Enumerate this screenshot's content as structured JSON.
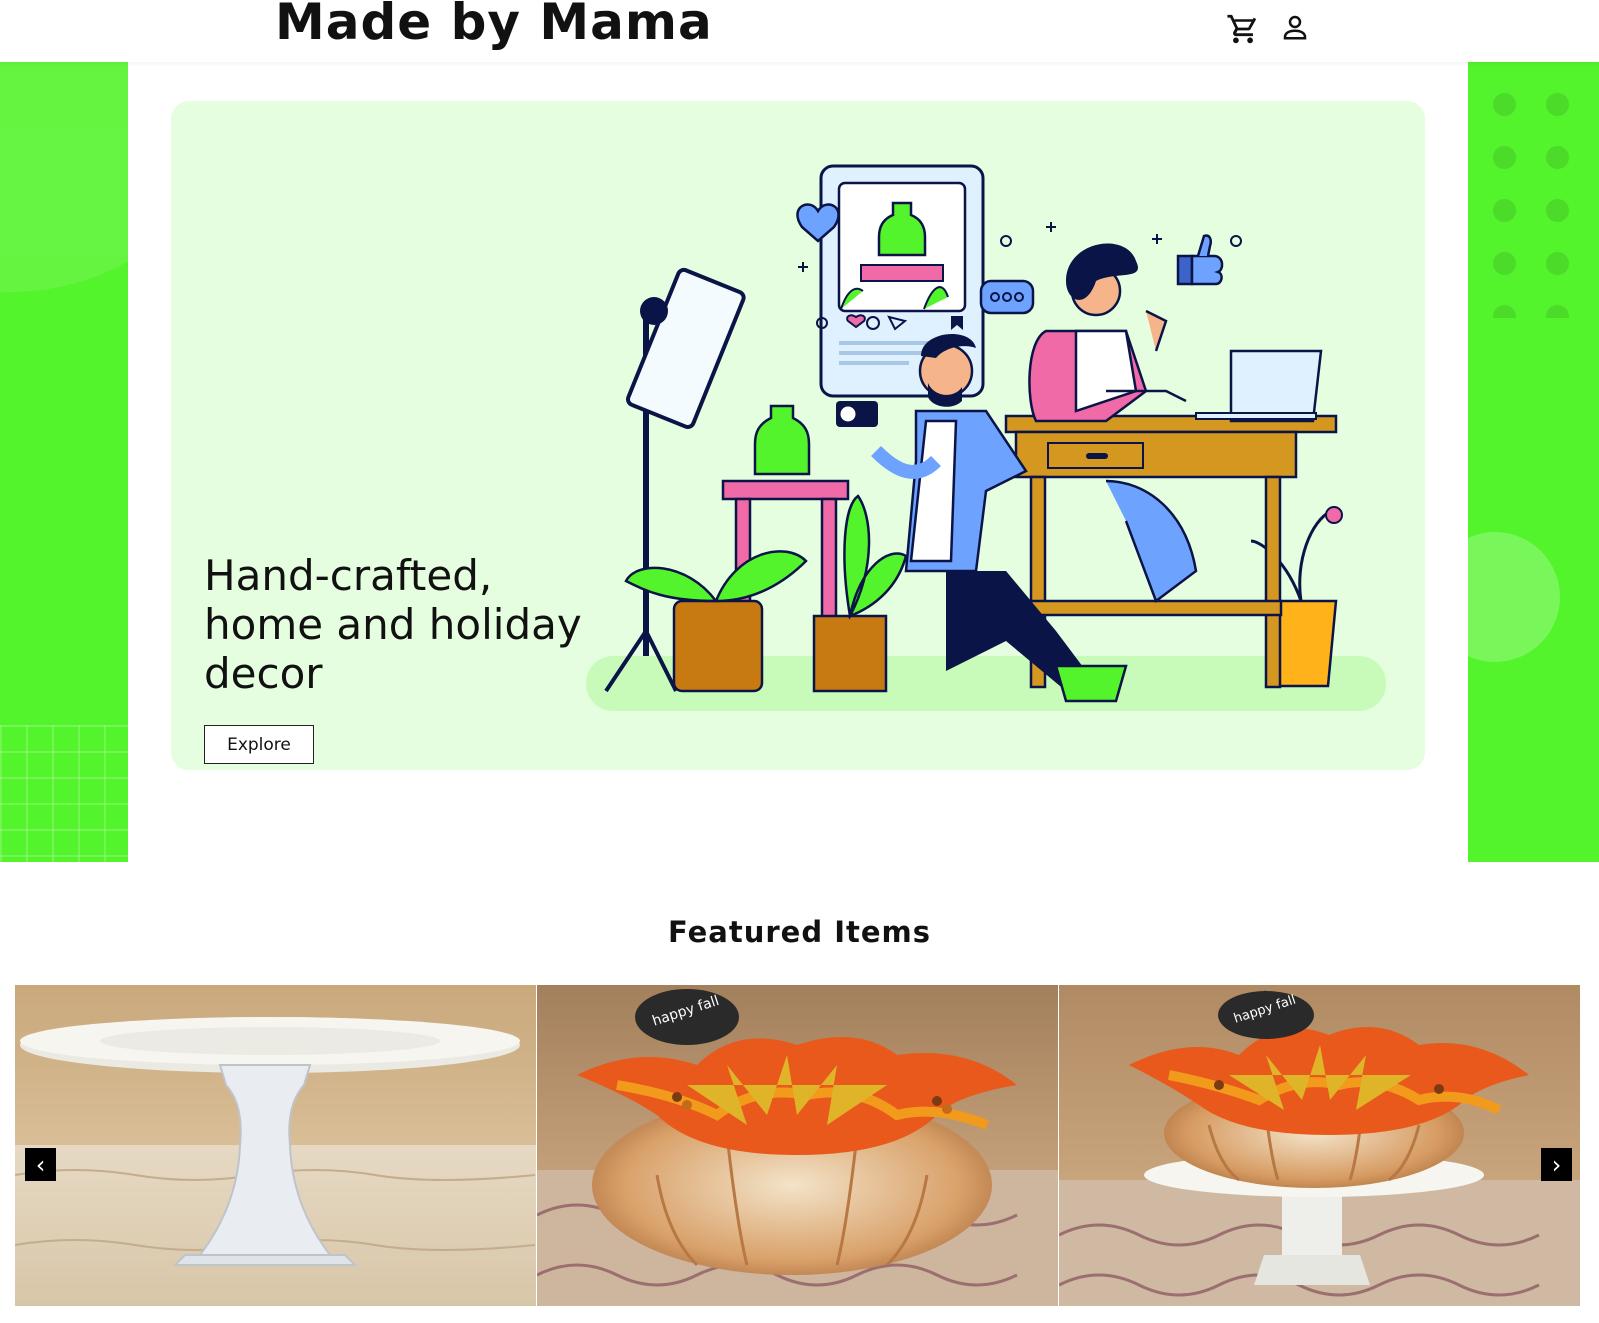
{
  "header": {
    "brand": "Made by Mama",
    "icons": {
      "cart": "cart-icon",
      "account": "user-icon"
    }
  },
  "hero": {
    "headline": "Hand-crafted, home and holiday decor",
    "cta_label": "Explore",
    "illustration": "photographer-and-crafter-illustration"
  },
  "featured": {
    "title": "Featured Items",
    "items": [
      {
        "image": "white-cake-stand-photo"
      },
      {
        "image": "happy-fall-pumpkin-photo",
        "sign_text": "happy fall"
      },
      {
        "image": "pumpkin-on-cake-stand-photo",
        "sign_text": "happy fall"
      }
    ],
    "prev_label": "‹",
    "next_label": "›"
  },
  "colors": {
    "brand_green": "#54f42c",
    "card_bg": "#e5fee0",
    "text": "#111111"
  }
}
